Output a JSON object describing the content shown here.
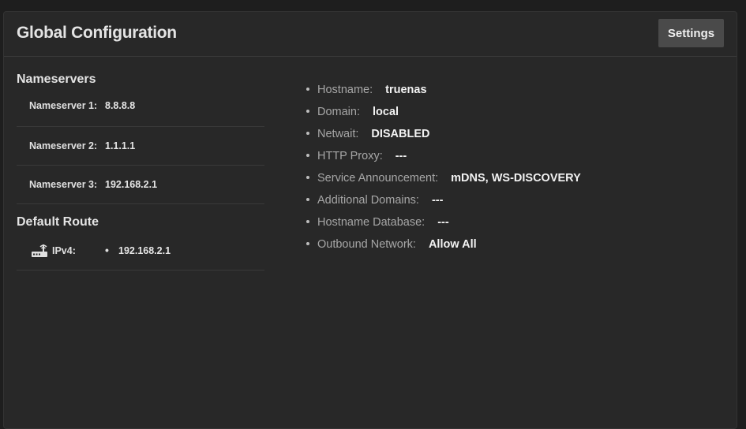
{
  "card": {
    "title": "Global Configuration",
    "settings_label": "Settings"
  },
  "nameservers": {
    "title": "Nameservers",
    "items": [
      {
        "label": "Nameserver 1:",
        "value": "8.8.8.8"
      },
      {
        "label": "Nameserver 2:",
        "value": "1.1.1.1"
      },
      {
        "label": "Nameserver 3:",
        "value": "192.168.2.1"
      }
    ]
  },
  "default_route": {
    "title": "Default Route",
    "icon": "router-icon",
    "label": "IPv4:",
    "value": "192.168.2.1"
  },
  "info": [
    {
      "key": "Hostname:",
      "value": "truenas"
    },
    {
      "key": "Domain:",
      "value": "local"
    },
    {
      "key": "Netwait:",
      "value": "DISABLED"
    },
    {
      "key": "HTTP Proxy:",
      "value": "---"
    },
    {
      "key": "Service Announcement:",
      "value": "mDNS, WS-DISCOVERY"
    },
    {
      "key": "Additional Domains:",
      "value": "---"
    },
    {
      "key": "Hostname Database:",
      "value": "---"
    },
    {
      "key": "Outbound Network:",
      "value": "Allow All"
    }
  ]
}
